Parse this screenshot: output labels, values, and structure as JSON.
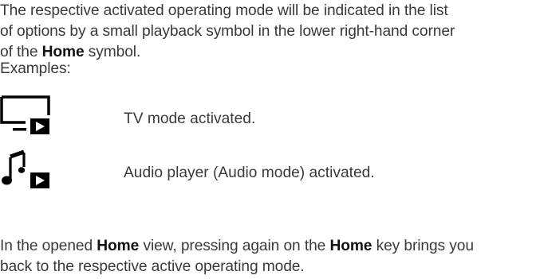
{
  "paragraph1": {
    "line1": "The respective activated operating mode will be indicated in the list",
    "line2": "of options by a small playback symbol in the lower right-hand corner",
    "line3_pre": "of the ",
    "line3_bold": "Home",
    "line3_post": " symbol."
  },
  "examples_label": "Examples:",
  "examples": [
    {
      "icon": "tv-mode-icon",
      "text": "TV mode activated."
    },
    {
      "icon": "audio-mode-icon",
      "text": "Audio player (Audio mode) activated."
    }
  ],
  "paragraph2": {
    "pre": "In the opened ",
    "bold1": "Home",
    "mid": " view, pressing again on the ",
    "bold2": "Home",
    "post": " key brings you",
    "line2": "back to the respective active operating mode."
  }
}
